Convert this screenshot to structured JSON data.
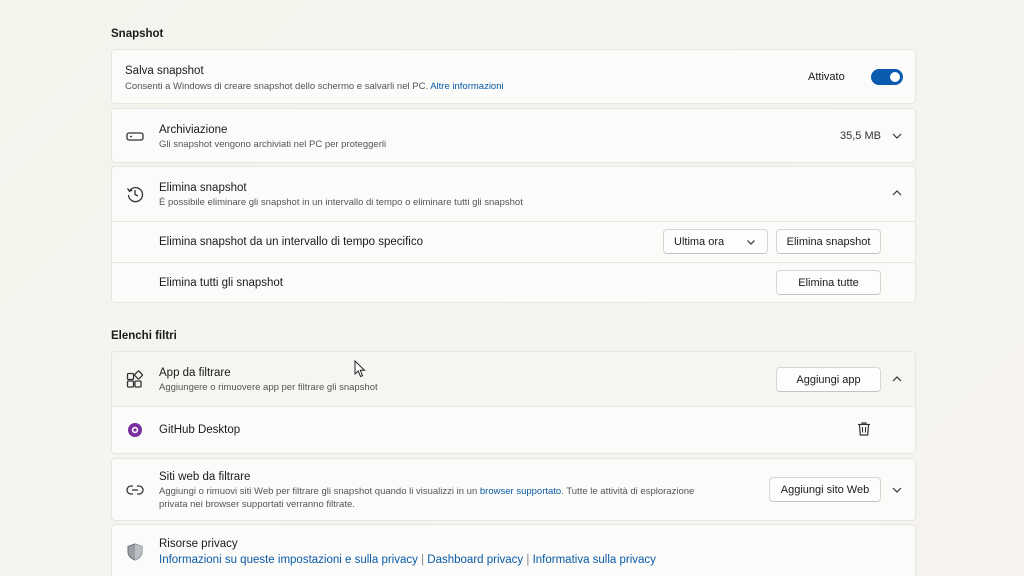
{
  "snapshot_section": {
    "title": "Snapshot",
    "save": {
      "title": "Salva snapshot",
      "desc": "Consenti a Windows di creare snapshot dello schermo e salvarli nel PC.",
      "link": "Altre informazioni",
      "state_label": "Attivato",
      "toggle_on": true
    },
    "storage": {
      "title": "Archiviazione",
      "desc": "Gli snapshot vengono archiviati nel PC per proteggerli",
      "size": "35,5 MB"
    },
    "delete": {
      "title": "Elimina snapshot",
      "desc": "È possibile eliminare gli snapshot in un intervallo di tempo o eliminare tutti gli snapshot",
      "range_label": "Elimina snapshot da un intervallo di tempo specifico",
      "range_select": "Ultima ora",
      "range_button": "Elimina snapshot",
      "all_label": "Elimina tutti gli snapshot",
      "all_button": "Elimina tutte"
    }
  },
  "filters_section": {
    "title": "Elenchi filtri",
    "apps": {
      "title": "App da filtrare",
      "desc": "Aggiungere o rimuovere app per filtrare gli snapshot",
      "add_button": "Aggiungi app",
      "items": [
        {
          "name": "GitHub Desktop",
          "icon": "github-desktop-icon"
        }
      ]
    },
    "sites": {
      "title": "Siti web da filtrare",
      "desc_1": "Aggiungi o rimuovi siti Web per filtrare gli snapshot quando li visualizzi in un",
      "desc_link": "browser supportato",
      "desc_2": ". Tutte le attività di esplorazione",
      "desc_3": "privata nei browser supportati verranno filtrate.",
      "add_button": "Aggiungi sito Web"
    },
    "privacy": {
      "title": "Risorse privacy",
      "links": [
        "Informazioni su queste impostazioni e sulla privacy",
        "Dashboard privacy",
        "Informativa sulla privacy"
      ],
      "separator": "|"
    }
  },
  "colors": {
    "accent": "#0a5ab0",
    "link": "#0a5aa8",
    "github_purple": "#7a2fa0"
  }
}
